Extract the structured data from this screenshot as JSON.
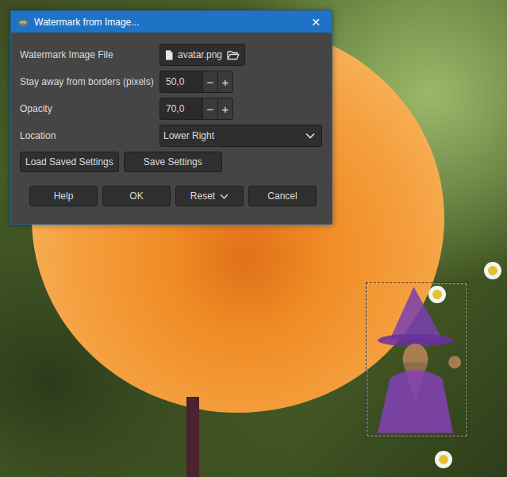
{
  "window": {
    "title": "Watermark from Image...",
    "close": "✕"
  },
  "fields": [
    {
      "kind": "file",
      "label": "Watermark Image File",
      "value": "avatar.png"
    },
    {
      "kind": "spin",
      "label": "Stay away from borders (pixels)",
      "value": "50,0",
      "minus": "−",
      "plus": "+"
    },
    {
      "kind": "spin",
      "label": "Opacity",
      "value": "70,0",
      "minus": "−",
      "plus": "+"
    },
    {
      "kind": "combo",
      "label": "Location",
      "value": "Lower Right"
    }
  ],
  "settings_buttons": [
    "Load Saved Settings",
    "Save Settings"
  ],
  "buttons": [
    {
      "label": "Help",
      "dropdown": false
    },
    {
      "label": "OK",
      "dropdown": false
    },
    {
      "label": "Reset",
      "dropdown": true
    },
    {
      "label": "Cancel",
      "dropdown": false
    }
  ],
  "canvas": {
    "selection": true
  }
}
